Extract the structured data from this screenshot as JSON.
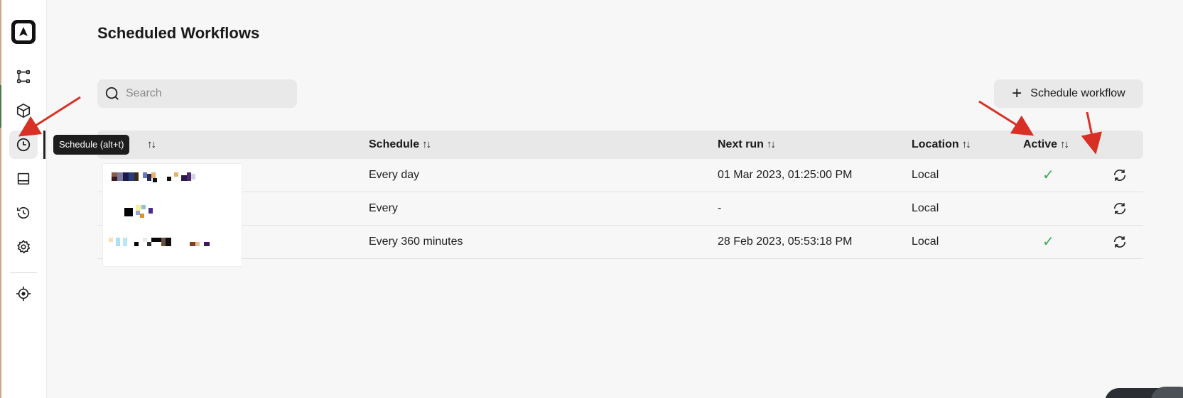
{
  "page": {
    "title": "Scheduled Workflows"
  },
  "sidebar": {
    "items": [
      {
        "name": "workflows",
        "icon": "workflow-icon"
      },
      {
        "name": "packages",
        "icon": "cube-icon"
      },
      {
        "name": "schedule",
        "icon": "clock-icon"
      },
      {
        "name": "panel",
        "icon": "panel-icon"
      },
      {
        "name": "history",
        "icon": "history-icon"
      },
      {
        "name": "settings",
        "icon": "gear-icon"
      },
      {
        "name": "target",
        "icon": "target-icon"
      }
    ],
    "tooltip": "Schedule (alt+t)"
  },
  "search": {
    "placeholder": "Search",
    "value": ""
  },
  "toolbar": {
    "schedule_label": "Schedule workflow"
  },
  "table": {
    "columns": [
      {
        "label": "Schedule",
        "sort": "↑↓"
      },
      {
        "label": "Next run",
        "sort": "↑↓"
      },
      {
        "label": "Location",
        "sort": "↑↓"
      },
      {
        "label": "Active",
        "sort": "↑↓"
      }
    ],
    "name_sort": "↑↓",
    "rows": [
      {
        "schedule": "Every day",
        "next_run": "01 Mar 2023, 01:25:00 PM",
        "location": "Local",
        "active": "✓"
      },
      {
        "schedule": "Every",
        "next_run": "-",
        "location": "Local",
        "active": ""
      },
      {
        "schedule": "Every 360 minutes",
        "next_run": "28 Feb 2023, 05:53:18 PM",
        "location": "Local",
        "active": "✓"
      }
    ]
  },
  "colors": {
    "accent": "#1a1a1a",
    "active_check": "#3aaa55",
    "annotation_arrow": "#d93025"
  }
}
